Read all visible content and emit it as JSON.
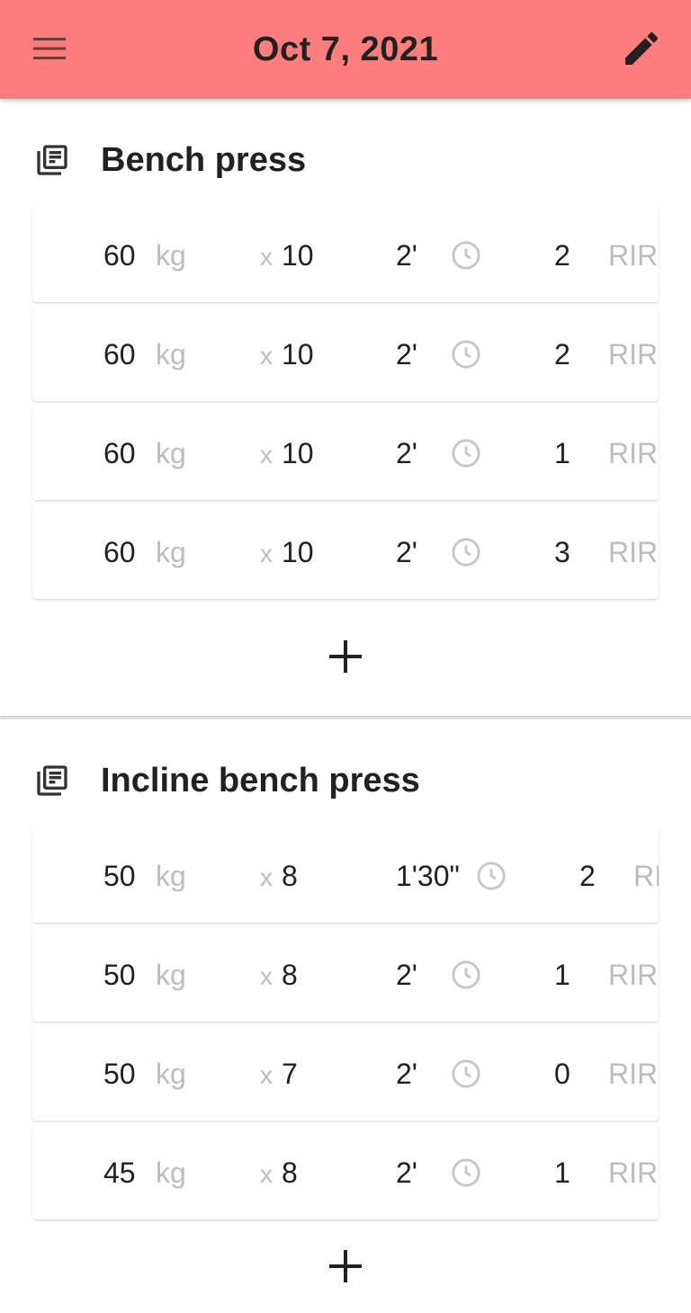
{
  "app_bar": {
    "title": "Oct 7, 2021",
    "background": "#ff7d7d",
    "left_icon": "menu-icon",
    "right_icon": "edit-icon"
  },
  "exercises": [
    {
      "name": "Bench press",
      "icon": "library-books-icon",
      "sets": [
        {
          "weight": "60",
          "unit": "kg",
          "x": "x",
          "reps": "10",
          "rest": "2'",
          "rir": "2",
          "rir_label": "RIR"
        },
        {
          "weight": "60",
          "unit": "kg",
          "x": "x",
          "reps": "10",
          "rest": "2'",
          "rir": "2",
          "rir_label": "RIR"
        },
        {
          "weight": "60",
          "unit": "kg",
          "x": "x",
          "reps": "10",
          "rest": "2'",
          "rir": "1",
          "rir_label": "RIR"
        },
        {
          "weight": "60",
          "unit": "kg",
          "x": "x",
          "reps": "10",
          "rest": "2'",
          "rir": "3",
          "rir_label": "RIR"
        }
      ],
      "add_icon": "plus-icon"
    },
    {
      "name": "Incline bench press",
      "icon": "library-books-icon",
      "sets": [
        {
          "weight": "50",
          "unit": "kg",
          "x": "x",
          "reps": "8",
          "rest": "1'30\"",
          "rir": "2",
          "rir_label": "RIR"
        },
        {
          "weight": "50",
          "unit": "kg",
          "x": "x",
          "reps": "8",
          "rest": "2'",
          "rir": "1",
          "rir_label": "RIR"
        },
        {
          "weight": "50",
          "unit": "kg",
          "x": "x",
          "reps": "7",
          "rest": "2'",
          "rir": "0",
          "rir_label": "RIR"
        },
        {
          "weight": "45",
          "unit": "kg",
          "x": "x",
          "reps": "8",
          "rest": "2'",
          "rir": "1",
          "rir_label": "RIR"
        }
      ],
      "add_icon": "plus-icon"
    }
  ]
}
